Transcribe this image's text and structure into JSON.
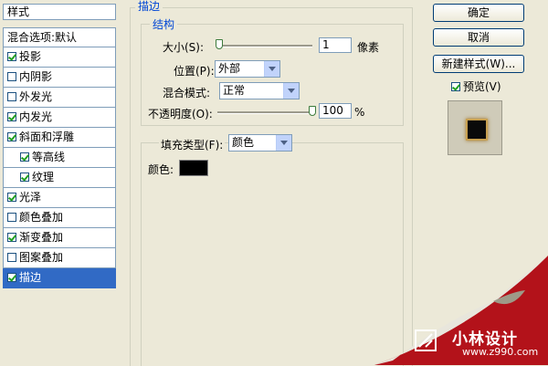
{
  "styles_panel": {
    "header": "样式",
    "blend_options": "混合选项:默认",
    "items": [
      {
        "label": "投影",
        "checked": true
      },
      {
        "label": "内阴影",
        "checked": false
      },
      {
        "label": "外发光",
        "checked": false
      },
      {
        "label": "内发光",
        "checked": true
      },
      {
        "label": "斜面和浮雕",
        "checked": true
      },
      {
        "label": "等高线",
        "checked": true
      },
      {
        "label": "纹理",
        "checked": true
      },
      {
        "label": "光泽",
        "checked": true
      },
      {
        "label": "颜色叠加",
        "checked": false
      },
      {
        "label": "渐变叠加",
        "checked": true
      },
      {
        "label": "图案叠加",
        "checked": false
      },
      {
        "label": "描边",
        "checked": true
      }
    ]
  },
  "stroke": {
    "section_title": "描边",
    "structure_title": "结构",
    "size_label": "大小(S):",
    "size_value": "1",
    "size_unit": "像素",
    "size_fraction": 0.0,
    "position_label": "位置(P):",
    "position_value": "外部",
    "blend_mode_label": "混合模式:",
    "blend_mode_value": "正常",
    "opacity_label": "不透明度(O):",
    "opacity_value": "100",
    "opacity_unit": "%",
    "opacity_fraction": 1.0,
    "fill_type_label": "填充类型(F):",
    "fill_type_value": "颜色",
    "color_label": "颜色:",
    "color_value": "#000000"
  },
  "buttons": {
    "ok": "确定",
    "cancel": "取消",
    "new_style": "新建样式(W)...",
    "preview_label": "预览(V)",
    "preview_checked": true
  },
  "watermark": {
    "title": "小林设计",
    "url": "www.z990.com"
  },
  "colors": {
    "selection": "#316ac5",
    "accent_red": "#b3121a"
  }
}
